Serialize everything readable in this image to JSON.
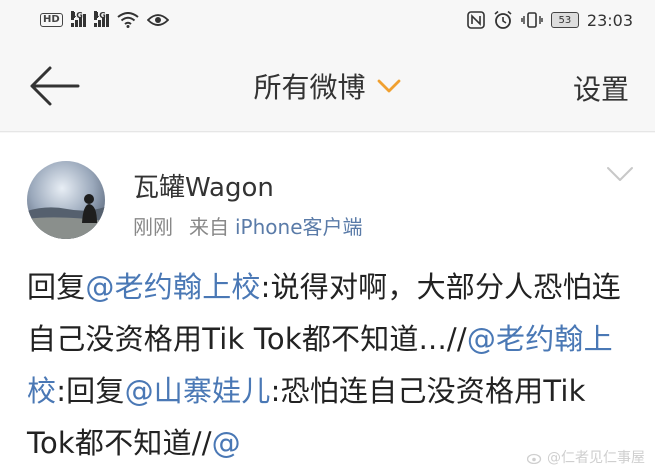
{
  "status_bar": {
    "left_badges": [
      "HD",
      "4G",
      "4G"
    ],
    "battery": "53",
    "time": "23:03"
  },
  "nav": {
    "title": "所有微博",
    "settings_label": "设置"
  },
  "post": {
    "username": "瓦罐Wagon",
    "time": "刚刚",
    "from_label": "来自",
    "source": "iPhone客户端",
    "body": [
      {
        "type": "text",
        "text": "回复"
      },
      {
        "type": "mention",
        "text": "@老约翰上校"
      },
      {
        "type": "text",
        "text": ":说得对啊，大部分人恐怕连自己没资格用Tik Tok都不知道...//"
      },
      {
        "type": "mention",
        "text": "@老约翰上校"
      },
      {
        "type": "text",
        "text": ":回复"
      },
      {
        "type": "mention",
        "text": "@山寨娃儿"
      },
      {
        "type": "text",
        "text": ":恐怕连自己没资格用Tik Tok都不知道//"
      },
      {
        "type": "mention",
        "text": "@"
      }
    ]
  },
  "watermark": "@仁者见仁事屋",
  "colors": {
    "accent_orange": "#f0a030",
    "mention_blue": "#4a78b5",
    "meta_gray": "#888888"
  }
}
